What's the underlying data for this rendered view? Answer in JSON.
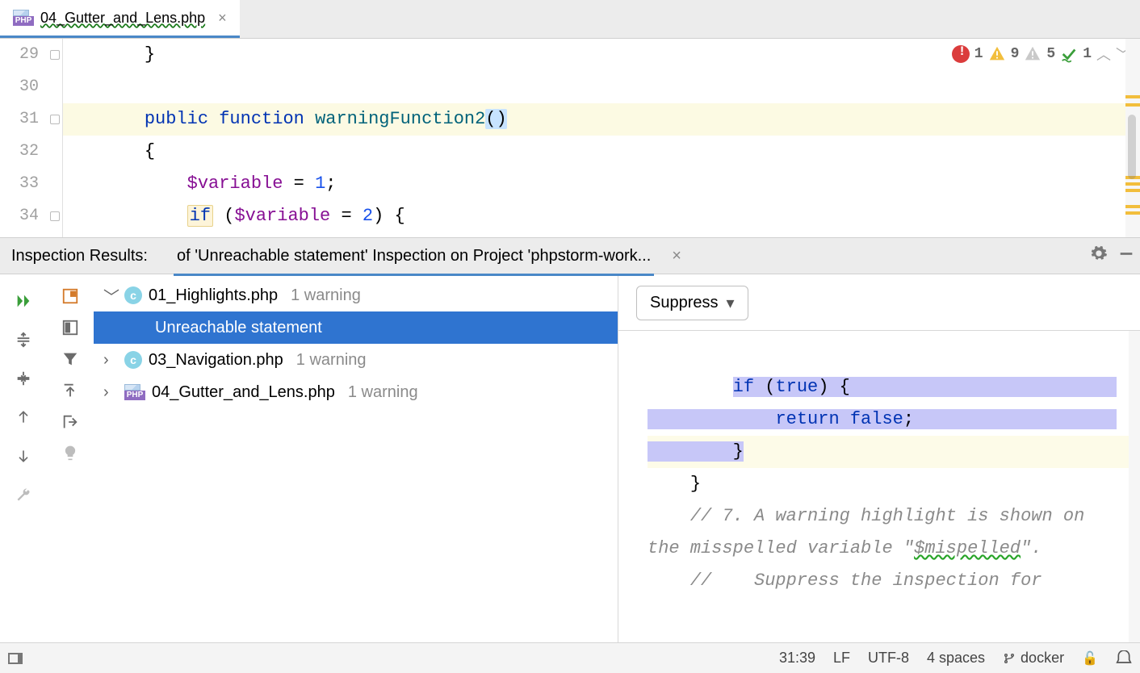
{
  "tab": {
    "filename": "04_Gutter_and_Lens.php"
  },
  "inspection_widget": {
    "error_count": "1",
    "warning_count": "9",
    "weak_count": "5",
    "ok_count": "1"
  },
  "editor": {
    "lines": [
      {
        "num": "29"
      },
      {
        "num": "30"
      },
      {
        "num": "31"
      },
      {
        "num": "32"
      },
      {
        "num": "33"
      },
      {
        "num": "34"
      }
    ],
    "l29_brace": "}",
    "l31_public": "public",
    "l31_function": "function",
    "l31_fn": "warningFunction2",
    "l31_parens": "()",
    "l32_brace": "{",
    "l33_var": "$variable",
    "l33_eq": " = ",
    "l33_one": "1",
    "l33_semi": ";",
    "l34_if": "if",
    "l34_open": " (",
    "l34_var": "$variable",
    "l34_eq": " = ",
    "l34_two": "2",
    "l34_close": ") {"
  },
  "panel": {
    "label": "Inspection Results:",
    "crumb": "of 'Unreachable statement' Inspection on Project 'phpstorm-work..."
  },
  "tree": {
    "items": [
      {
        "file": "01_Highlights.php",
        "sub": "1 warning",
        "icon": "c",
        "expanded": true
      },
      {
        "file": "Unreachable statement",
        "sub": "",
        "selected": true,
        "child": true
      },
      {
        "file": "03_Navigation.php",
        "sub": "1 warning",
        "icon": "c",
        "expanded": false
      },
      {
        "file": "04_Gutter_and_Lens.php",
        "sub": "1 warning",
        "icon": "php",
        "expanded": false
      }
    ]
  },
  "suppress": {
    "label": "Suppress"
  },
  "preview": {
    "if": "if",
    "op": " (",
    "true": "true",
    "cp": ") {",
    "return": "return",
    "sp": " ",
    "false": "false",
    "semi": ";",
    "brace1": "}",
    "brace2": "}",
    "c1a": "// 7. A warning highlight is shown on",
    "c1b_pre": "the misspelled variable \"",
    "c1b_var": "$mispelled",
    "c1b_post": "\".",
    "c2": "//    Suppress the inspection for"
  },
  "status": {
    "pos": "31:39",
    "lf": "LF",
    "enc": "UTF-8",
    "indent": "4 spaces",
    "branch": "docker"
  }
}
